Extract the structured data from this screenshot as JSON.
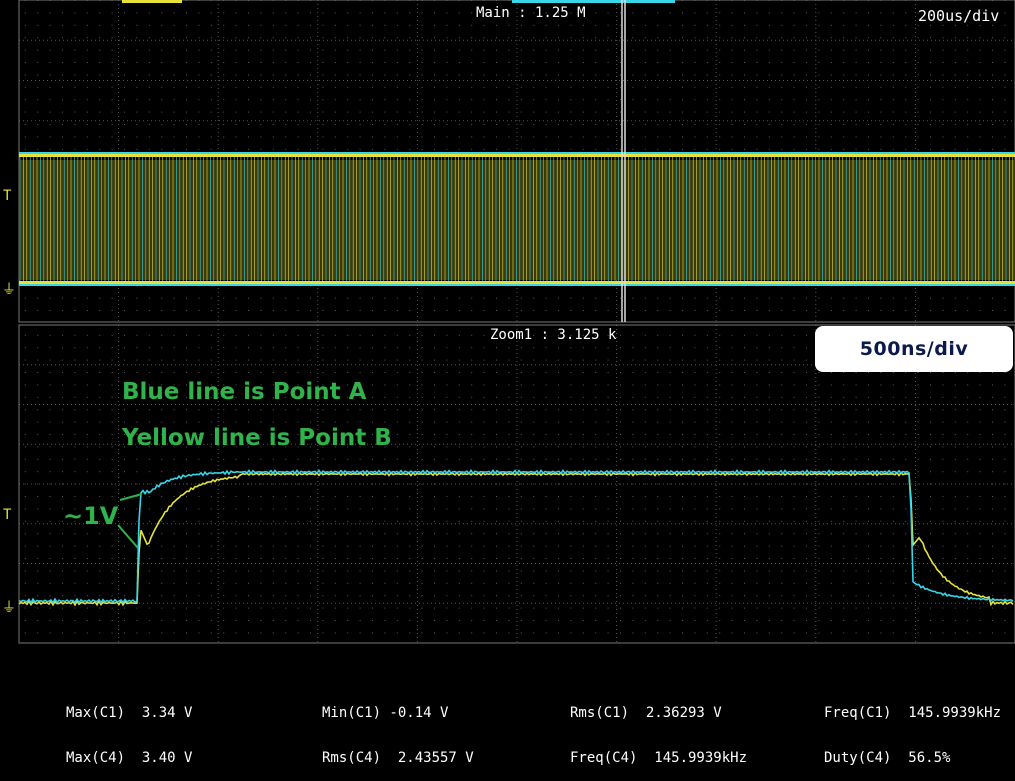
{
  "main": {
    "header": "Main : 1.25 M",
    "timebase": "200us/div"
  },
  "zoom": {
    "header": "Zoom1 : 3.125 k",
    "timebase": "500ns/div"
  },
  "annotations": {
    "line1": "Blue line is Point A",
    "line2": "Yellow line is Point B",
    "voltage": "~1V"
  },
  "colors": {
    "channel_a": "#37d6e8",
    "channel_b": "#e6e23a",
    "annotation": "#2fb34a",
    "grid": "#4a4a4a"
  },
  "measurements": [
    {
      "row1": "Max(C1)  3.34 V",
      "row2": "Max(C4)  3.40 V"
    },
    {
      "row1": "Min(C1) -0.14 V",
      "row2": "Rms(C4)  2.43557 V"
    },
    {
      "row1": "Rms(C1)  2.36293 V",
      "row2": "Freq(C4)  145.9939kHz"
    },
    {
      "row1": "Freq(C1)  145.9939kHz",
      "row2": "Duty(C4)  56.5%"
    }
  ]
}
